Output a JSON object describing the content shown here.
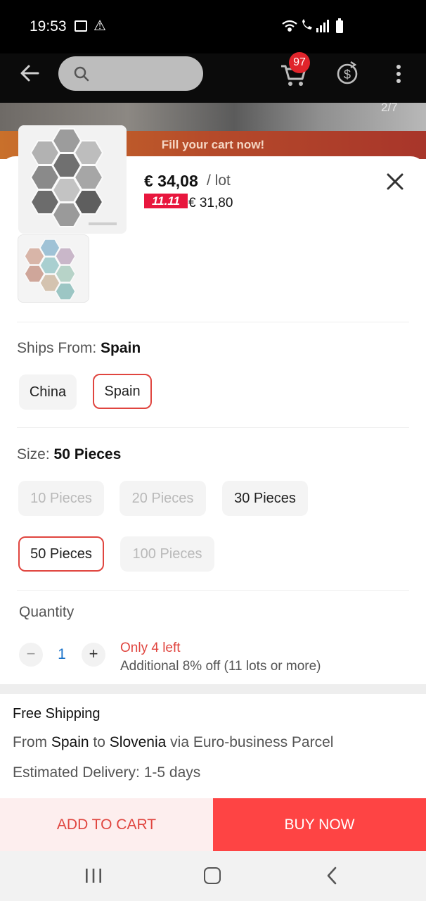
{
  "status_bar": {
    "time": "19:53"
  },
  "header": {
    "cart_count": "97"
  },
  "gallery": {
    "counter": "2/7"
  },
  "promo": {
    "text": "Fill your cart now!"
  },
  "price": {
    "main": "€ 34,08",
    "unit": "/ lot",
    "sale_badge": "11.11",
    "sale_price": "€ 31,80"
  },
  "ships_from": {
    "label": "Ships From:",
    "selected": "Spain",
    "options": [
      "China",
      "Spain"
    ]
  },
  "size": {
    "label": "Size:",
    "selected": "50 Pieces",
    "options": [
      "10 Pieces",
      "20 Pieces",
      "30 Pieces",
      "50 Pieces",
      "100 Pieces"
    ]
  },
  "quantity": {
    "label": "Quantity",
    "value": "1",
    "minus": "−",
    "plus": "+",
    "stock_note": "Only 4 left",
    "discount_note": "Additional 8% off (11 lots or more)"
  },
  "shipping": {
    "title": "Free Shipping",
    "from_prefix": "From",
    "from": "Spain",
    "to_prefix": "to",
    "to": "Slovenia",
    "via": "via Euro-business Parcel",
    "estimate": "Estimated Delivery: 1-5 days"
  },
  "actions": {
    "add_to_cart": "ADD TO CART",
    "buy_now": "BUY NOW"
  },
  "colors": {
    "accent": "#e0453f",
    "buy_bg": "#fe4444",
    "cart_bg": "#fdeeee",
    "badge": "#e8163d"
  }
}
